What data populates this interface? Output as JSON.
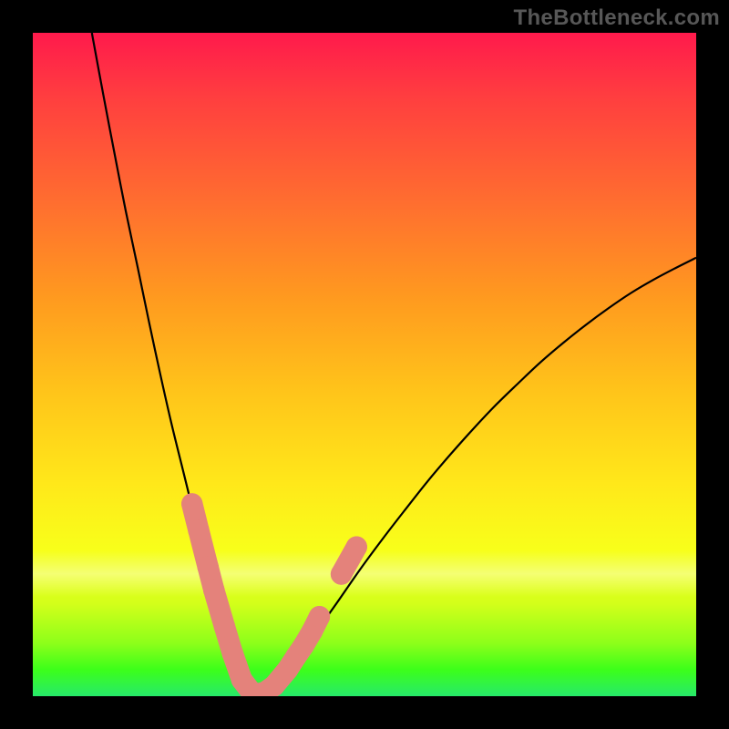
{
  "watermark": "TheBottleneck.com",
  "colors": {
    "background": "#000000",
    "curve": "#000000",
    "marker": "#e4827b",
    "gradient_top": "#ff1a4c",
    "gradient_bottom": "#27e96a"
  },
  "chart_data": {
    "type": "line",
    "title": "",
    "xlabel": "",
    "ylabel": "",
    "xlim": [
      0,
      100
    ],
    "ylim": [
      0,
      100
    ],
    "series": [
      {
        "name": "left-branch",
        "x": [
          8.9,
          10.6,
          12.3,
          14.0,
          15.8,
          17.5,
          19.2,
          20.9,
          22.7,
          24.4,
          25.6,
          26.9,
          28.1,
          29.3,
          30.6,
          31.8
        ],
        "y": [
          100,
          90.8,
          81.9,
          73.2,
          64.7,
          56.5,
          48.6,
          41.1,
          33.8,
          26.9,
          22.3,
          17.7,
          13.3,
          9.1,
          5.0,
          1.1
        ]
      },
      {
        "name": "valley",
        "x": [
          31.8,
          32.6,
          33.4,
          34.1,
          34.9,
          35.7
        ],
        "y": [
          1.1,
          0.4,
          0.1,
          0.0,
          0.2,
          0.6
        ]
      },
      {
        "name": "right-branch",
        "x": [
          35.7,
          38.2,
          40.7,
          43.3,
          46.0,
          49.4,
          52.8,
          56.2,
          59.6,
          63.0,
          66.4,
          69.8,
          73.2,
          76.6,
          80.0,
          83.4,
          86.8,
          90.2,
          93.6,
          97.0,
          100.0
        ],
        "y": [
          0.6,
          3.3,
          6.8,
          10.5,
          14.3,
          19.2,
          23.8,
          28.2,
          32.5,
          36.5,
          40.3,
          43.9,
          47.2,
          50.4,
          53.3,
          56.0,
          58.5,
          60.8,
          62.8,
          64.6,
          66.1
        ]
      }
    ],
    "markers": {
      "name": "highlighted-points",
      "color": "#e4827b",
      "radius_pct": 1.6,
      "points": [
        {
          "x": 24.0,
          "y": 29.0
        },
        {
          "x": 25.0,
          "y": 25.0
        },
        {
          "x": 26.4,
          "y": 19.5
        },
        {
          "x": 27.3,
          "y": 16.0
        },
        {
          "x": 28.9,
          "y": 10.5
        },
        {
          "x": 30.1,
          "y": 6.5
        },
        {
          "x": 31.5,
          "y": 2.5
        },
        {
          "x": 32.8,
          "y": 0.8
        },
        {
          "x": 33.7,
          "y": 0.3
        },
        {
          "x": 35.0,
          "y": 0.6
        },
        {
          "x": 36.4,
          "y": 1.6
        },
        {
          "x": 38.4,
          "y": 4.0
        },
        {
          "x": 39.7,
          "y": 6.0
        },
        {
          "x": 40.8,
          "y": 7.6
        },
        {
          "x": 42.1,
          "y": 9.8
        },
        {
          "x": 43.2,
          "y": 12.0
        },
        {
          "x": 46.5,
          "y": 18.4
        },
        {
          "x": 48.8,
          "y": 22.5
        }
      ]
    }
  }
}
